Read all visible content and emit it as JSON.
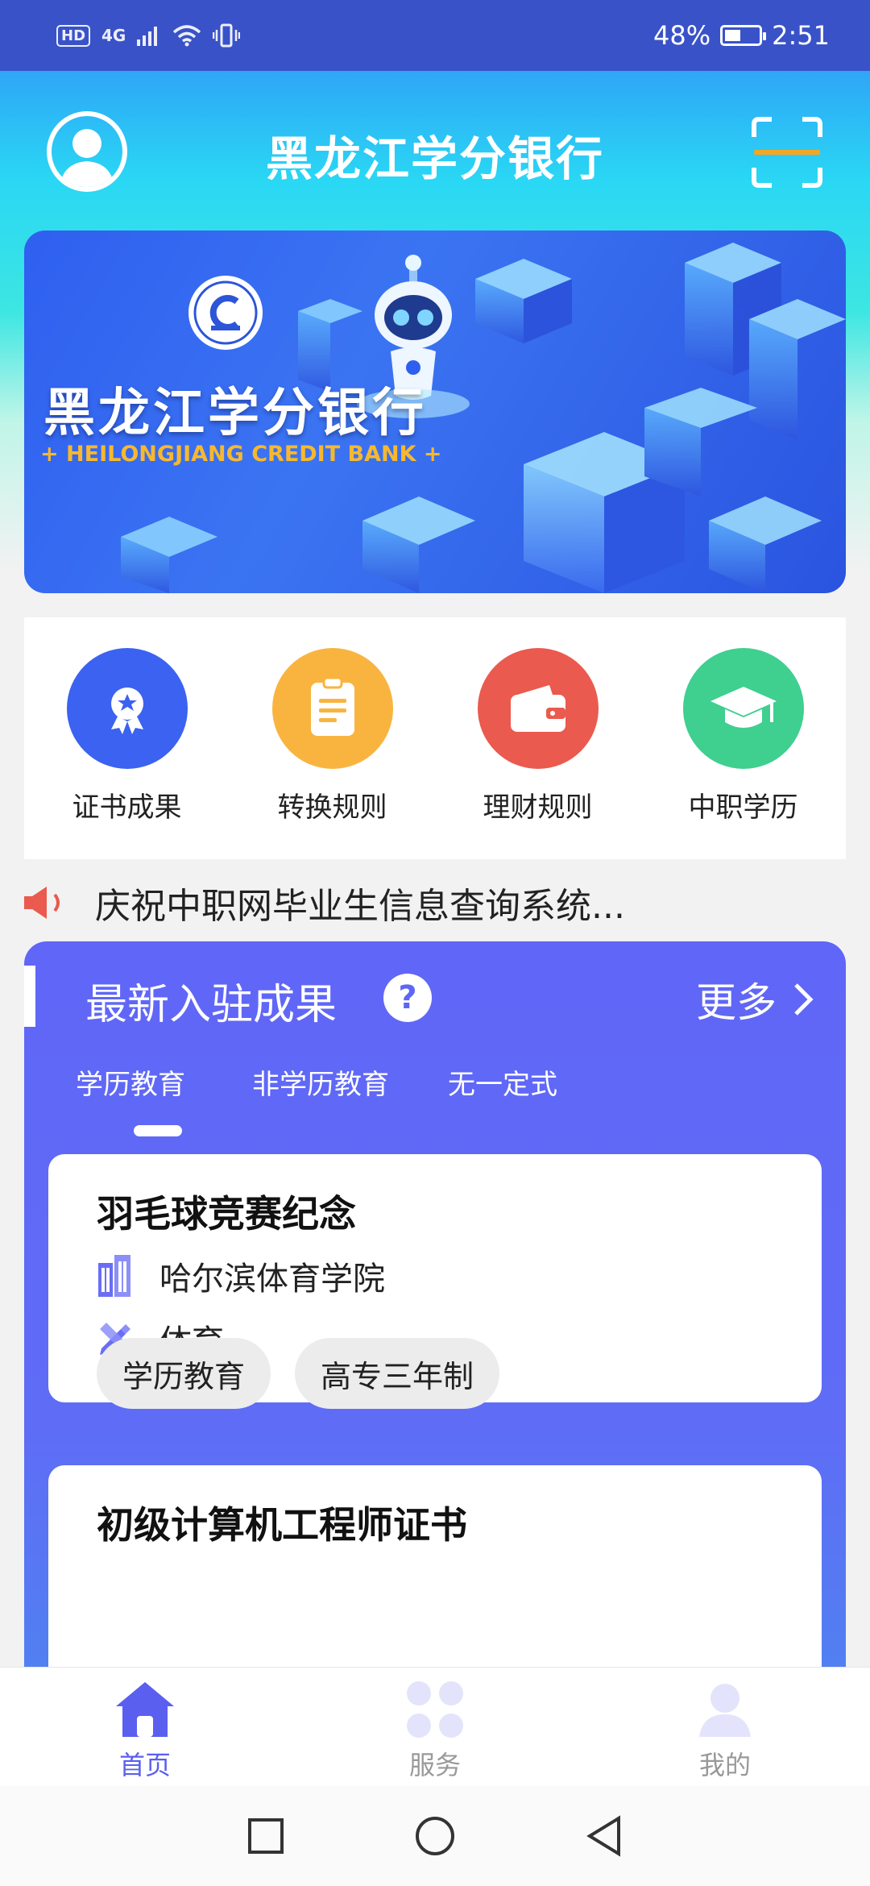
{
  "status_bar": {
    "network_badge": "HD",
    "network_type": "4G",
    "battery_percent": "48%",
    "battery_level": 0.48,
    "time": "2:51"
  },
  "header": {
    "title": "黑龙江学分银行"
  },
  "banner": {
    "title": "黑龙江学分银行",
    "subtitle": "+ HEILONGJIANG CREDIT BANK +"
  },
  "quick_menu": [
    {
      "label": "证书成果",
      "color": "#3b62f0",
      "icon": "award-icon"
    },
    {
      "label": "转换规则",
      "color": "#f9b440",
      "icon": "document-icon"
    },
    {
      "label": "理财规则",
      "color": "#ea5a4e",
      "icon": "wallet-icon"
    },
    {
      "label": "中职学历",
      "color": "#3fcf8f",
      "icon": "graduation-cap-icon"
    }
  ],
  "notice": {
    "text": "庆祝中职网毕业生信息查询系统..."
  },
  "achievements": {
    "title": "最新入驻成果",
    "more_label": "更多",
    "tabs": [
      "学历教育",
      "非学历教育",
      "无一定式"
    ],
    "active_tab": 0,
    "cards": [
      {
        "title": "羽毛球竞赛纪念",
        "school": "哈尔滨体育学院",
        "field": "体育",
        "tags": [
          "学历教育",
          "高专三年制"
        ]
      },
      {
        "title": "初级计算机工程师证书"
      }
    ]
  },
  "bottom_nav": [
    {
      "label": "首页",
      "icon": "home-icon",
      "active": true
    },
    {
      "label": "服务",
      "icon": "services-icon",
      "active": false
    },
    {
      "label": "我的",
      "icon": "profile-icon",
      "active": false
    }
  ],
  "colors": {
    "accent": "#5d66f5",
    "nav_active": "#5a5ff0",
    "nav_inactive": "#999999"
  }
}
